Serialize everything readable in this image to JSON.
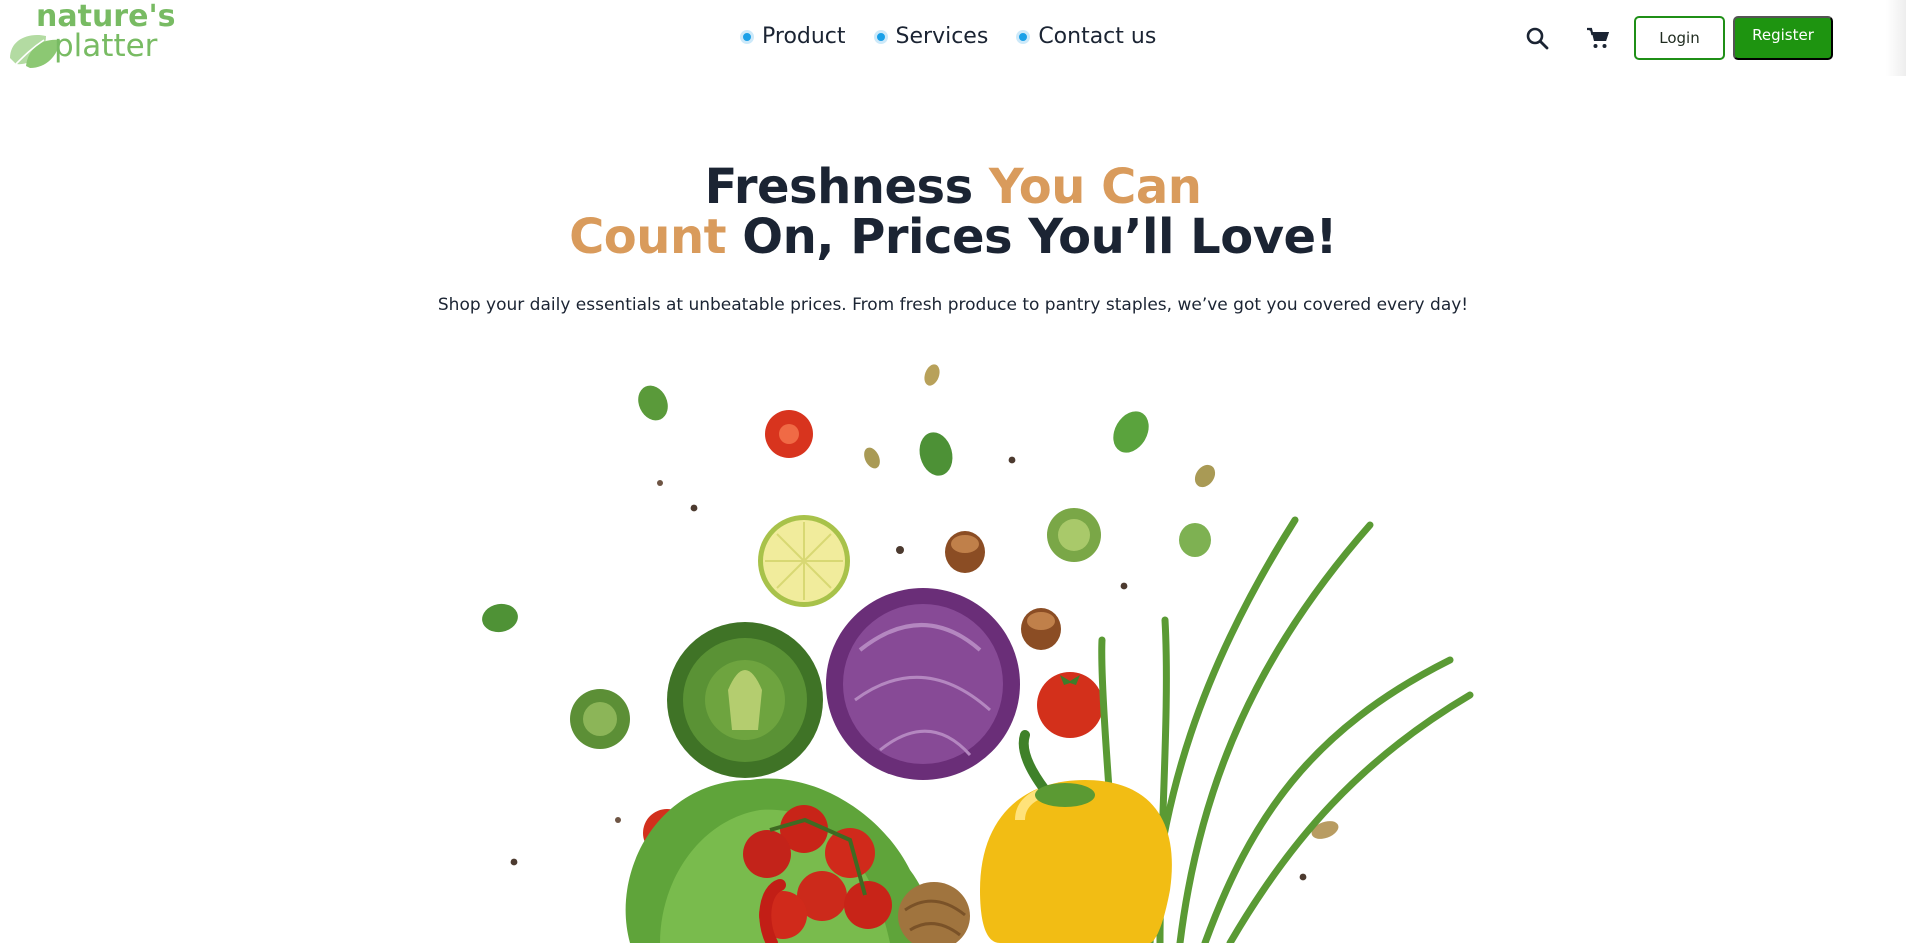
{
  "brand": {
    "line1": "nature's",
    "line2": "platter",
    "color": "#78bb63"
  },
  "nav": {
    "items": [
      {
        "label": "Product"
      },
      {
        "label": "Services"
      },
      {
        "label": "Contact us"
      }
    ],
    "dot_color": "#1aa0e8"
  },
  "header": {
    "search_icon": "search-icon",
    "cart_icon": "cart-icon",
    "login_label": "Login",
    "register_label": "Register",
    "register_color": "#1e9410"
  },
  "hero": {
    "title_part1": "Freshness ",
    "title_accent1": "You Can",
    "title_accent2": "Count",
    "title_part2": " On, Prices You’ll Love!",
    "accent_color": "#d99b5c",
    "subtitle": "Shop your daily essentials at unbeatable prices. From fresh produce to pantry staples, we’ve got you covered every day!"
  }
}
